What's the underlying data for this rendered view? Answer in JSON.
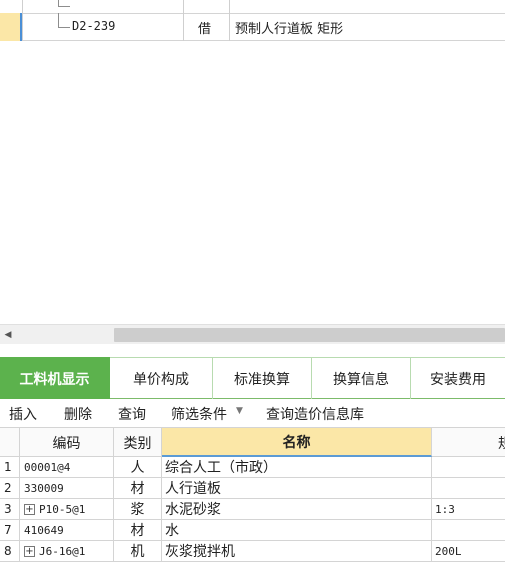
{
  "top_grid": {
    "rows": [
      {
        "code": "",
        "type": "",
        "name": ""
      },
      {
        "code": "D2-239",
        "type": "借",
        "name": "预制人行道板 矩形"
      }
    ]
  },
  "tabs": [
    {
      "label": "工料机显示",
      "active": true
    },
    {
      "label": "单价构成",
      "active": false
    },
    {
      "label": "标准换算",
      "active": false
    },
    {
      "label": "换算信息",
      "active": false
    },
    {
      "label": "安装费用",
      "active": false
    }
  ],
  "toolbar": {
    "insert": "插入",
    "delete": "删除",
    "query": "查询",
    "filter": "筛选条件",
    "price_info": "查询造价信息库"
  },
  "grid": {
    "headers": {
      "code": "编码",
      "type": "类别",
      "name": "名称",
      "spec": "规"
    },
    "rows": [
      {
        "num": "1",
        "code": "00001@4",
        "type": "人",
        "name": "综合人工（市政）",
        "spec": "",
        "expandable": false
      },
      {
        "num": "2",
        "code": "330009",
        "type": "材",
        "name": "人行道板",
        "spec": "",
        "expandable": false
      },
      {
        "num": "3",
        "code": "P10-5@1",
        "type": "浆",
        "name": "水泥砂浆",
        "spec": "1:3",
        "expandable": true
      },
      {
        "num": "7",
        "code": "410649",
        "type": "材",
        "name": "水",
        "spec": "",
        "expandable": false
      },
      {
        "num": "8",
        "code": "J6-16@1",
        "type": "机",
        "name": "灰浆搅拌机",
        "spec": "200L",
        "expandable": true
      }
    ]
  },
  "colors": {
    "tab_active": "#5cb24d",
    "name_header": "#fbe7a7",
    "selection_marker": "#4a8fd6"
  }
}
